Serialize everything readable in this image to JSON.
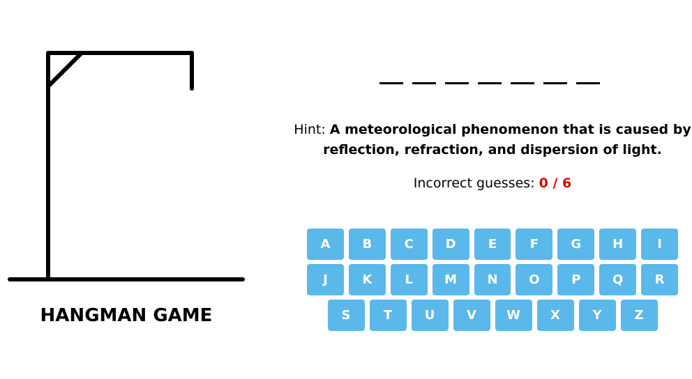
{
  "game": {
    "title": "HANGMAN GAME",
    "word_blanks": 7
  },
  "hint": {
    "label": "Hint:",
    "text": "A meteorological phenomenon that is caused by reflection, refraction, and dispersion of light."
  },
  "guesses": {
    "label": "Incorrect guesses:",
    "count": "0 / 6",
    "count_color": "#e00000"
  },
  "keyboard": {
    "key_color": "#5ab8ea",
    "rows": [
      [
        "A",
        "B",
        "C",
        "D",
        "E",
        "F",
        "G",
        "H",
        "I"
      ],
      [
        "J",
        "K",
        "L",
        "M",
        "N",
        "O",
        "P",
        "Q",
        "R"
      ],
      [
        "S",
        "T",
        "U",
        "V",
        "W",
        "X",
        "Y",
        "Z"
      ]
    ]
  }
}
